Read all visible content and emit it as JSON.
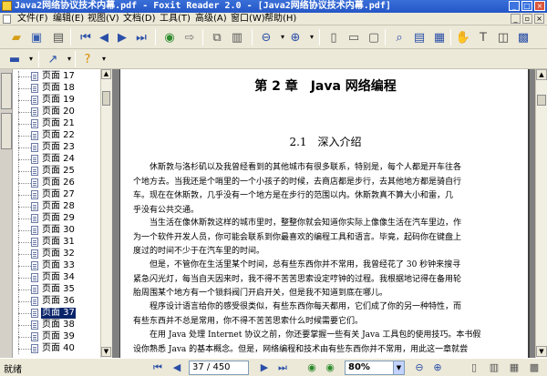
{
  "window": {
    "title": "Java2网络协议技术内幕.pdf - Foxit Reader 2.0 - [Java2网络协议技术内幕.pdf]",
    "minimize": "_",
    "maximize": "□",
    "close": "×"
  },
  "menu": {
    "items": [
      "文件(F)",
      "编辑(E)",
      "视图(V)",
      "文档(D)",
      "工具(T)",
      "高级(A)",
      "窗口(W)",
      "帮助(H)"
    ],
    "mdi_minimize": "_",
    "mdi_restore": "▫",
    "mdi_close": "×"
  },
  "icons": {
    "open": "folder-open-icon",
    "save": "save-icon",
    "print": "print-icon",
    "first": "first-page-icon",
    "prev": "previous-page-icon",
    "next": "next-page-icon",
    "last": "last-page-icon",
    "back": "back-icon",
    "forward": "forward-icon",
    "zoom_out": "zoom-out-icon",
    "zoom_in": "zoom-in-icon",
    "hand": "hand-tool-icon",
    "select": "select-text-icon",
    "snapshot": "snapshot-icon",
    "bookmark": "bookmark-panel-icon",
    "help": "help-icon"
  },
  "colors": {
    "titlebar": "#2456c7",
    "selection": "#0a246a",
    "nav_blue": "#2b4fa8",
    "nav_green": "#2e8b2e"
  },
  "tree": {
    "pages": [
      "页面 17",
      "页面 18",
      "页面 19",
      "页面 20",
      "页面 21",
      "页面 22",
      "页面 23",
      "页面 24",
      "页面 25",
      "页面 26",
      "页面 27",
      "页面 28",
      "页面 29",
      "页面 30",
      "页面 31",
      "页面 32",
      "页面 33",
      "页面 34",
      "页面 35",
      "页面 36",
      "页面 37",
      "页面 38",
      "页面 39",
      "页面 40"
    ],
    "selected": "页面 37"
  },
  "document": {
    "chapter": "第 2 章　Java 网络编程",
    "section": "2.1　深入介绍",
    "para1": [
      "休斯敦与洛杉矶以及我曾经看到的其他城市有很多联系，特别是，每个人都是开车往各",
      "个地方去。当我还是个哨里的一个小孩子的时候，去商店都是步行，去其他地方都是骑自行",
      "车。现在在休斯敦，几乎没有一个地方是在步行的范围以内。休斯敦真不算大小和雷，几",
      "乎没有公共交通。"
    ],
    "para2": [
      "当生活在像休斯敦这样的城市里时，整整你就会知道你实际上像像生活在汽车里边，作",
      "为一个软件开发人员，你可能会联系到你最喜欢的编程工具和语言。毕竟，起码你在键盘上",
      "度过的时间不少于在汽车里的时间。"
    ],
    "para3": [
      "但是，不管你在生活里某个时间，总有些东西你并不常用，我曾经花了 30 秒钟来搜寻",
      "紧急闪光灯，每当自天因来时，我不得不苦苦思索设定哼钟的过程。我根据地记得在备用轮",
      "胎周围某个地方有一个锁斜阀门开启开关，但是我不知道到底在哪儿。"
    ],
    "para4": [
      "程序设计语言给你的感受很类似，有些东西你每天都用，它们成了你的另一种特性，而",
      "有些东西并不总是常用，你不得不苦苦思索什么时候需要它们。"
    ],
    "para5": [
      "在用 Java 处理 Internet 协议之前，你还要掌握一些有关 Java 工具包的使用技巧。本书假",
      "设你熟悉 Java 的基本概念。但是，网络编程和技术由有些东西你并不常用，用此这一章就尝"
    ]
  },
  "status": {
    "text": "就绪",
    "page_value": "37 / 450",
    "zoom_value": "80%"
  }
}
